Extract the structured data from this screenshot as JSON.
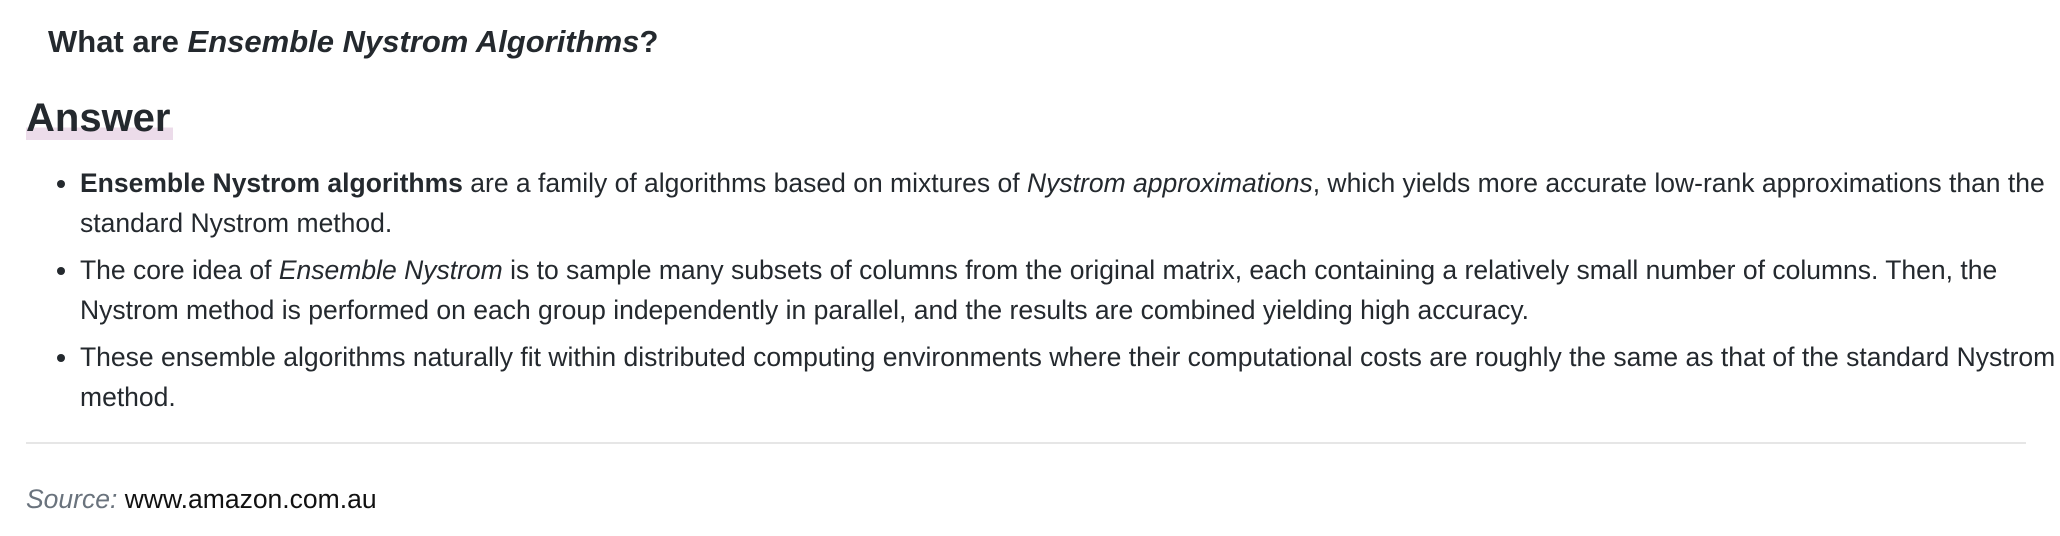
{
  "question": {
    "prefix": "What are ",
    "emphasis": "Ensemble Nystrom Algorithms",
    "suffix": "?"
  },
  "answer_heading": "Answer",
  "bullets": [
    {
      "bold": "Ensemble Nystrom algorithms",
      "t1": " are a family of algorithms based on mixtures of ",
      "em": "Nystrom approximations",
      "t2": ", which yields more accurate low-rank approximations than the standard Nystrom method."
    },
    {
      "t0": "The core idea of ",
      "em": "Ensemble Nystrom",
      "t1": " is to sample many subsets of columns from the original matrix, each containing a relatively small number of columns. Then, the Nystrom method is performed on each group independently in parallel, and the results are combined yielding high accuracy."
    },
    {
      "t0": "These ensemble algorithms naturally fit within distributed computing environments where their computational costs are roughly the same as that of the standard Nystrom method."
    }
  ],
  "source": {
    "label": "Source:",
    "value": "www.amazon.com.au"
  }
}
